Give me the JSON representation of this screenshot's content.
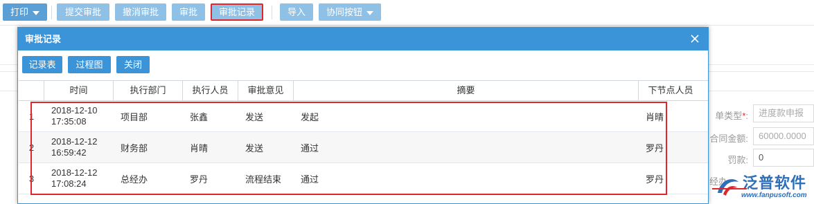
{
  "toolbar": {
    "print": "打印",
    "submit_approval": "提交审批",
    "cancel_approval": "撤消审批",
    "approve": "审批",
    "approval_record": "审批记录",
    "import": "导入",
    "collab_button": "协同按钮"
  },
  "background_form": {
    "doc_type_label": "单类型",
    "doc_type_value": "进度款申报",
    "contract_amount_label": "合同金额:",
    "contract_amount_value": "60000.0000",
    "penalty_label": "罚款:",
    "penalty_value": "0",
    "handler_label": "经办"
  },
  "logo": {
    "name": "泛普软件",
    "url": "www.fanpusoft.com"
  },
  "dialog": {
    "title": "审批记录",
    "buttons": {
      "record_table": "记录表",
      "process_chart": "过程图",
      "close": "关闭"
    },
    "columns": [
      "时间",
      "执行部门",
      "执行人员",
      "审批意见",
      "摘要",
      "下节点人员"
    ],
    "rows": [
      {
        "no": "1",
        "date": "2018-12-10",
        "time": "17:35:08",
        "dept": "项目部",
        "person": "张鑫",
        "opinion": "发送",
        "summary": "发起",
        "next": "肖晴"
      },
      {
        "no": "2",
        "date": "2018-12-12",
        "time": "16:59:42",
        "dept": "财务部",
        "person": "肖晴",
        "opinion": "发送",
        "summary": "通过",
        "next": "罗丹"
      },
      {
        "no": "3",
        "date": "2018-12-12",
        "time": "17:08:24",
        "dept": "总经办",
        "person": "罗丹",
        "opinion": "流程结束",
        "summary": "通过",
        "next": "罗丹"
      }
    ]
  },
  "colors": {
    "accent": "#3b93d8",
    "toolbar_button": "#8fc0e6",
    "highlight_border": "#e0262d"
  }
}
